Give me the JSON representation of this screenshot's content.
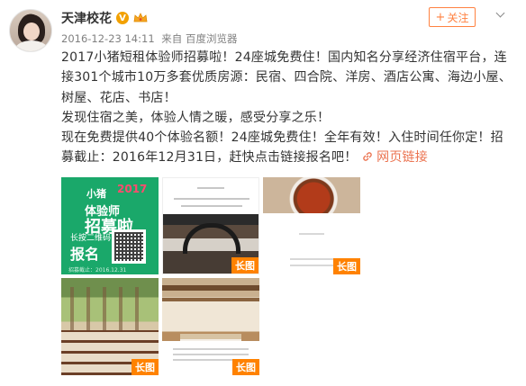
{
  "user": {
    "name": "天津校花",
    "vip_badge": "V",
    "follow_label": "关注",
    "follow_plus": "+"
  },
  "meta": {
    "date": "2016-12-23 14:11",
    "source_prefix": "来自",
    "source": "百度浏览器"
  },
  "post": {
    "paragraph1": "2017小猪短租体验师招募啦！24座城免费住！国内知名分享经济住宿平台，连接301个城市10万多套优质房源：民宿、四合院、洋房、酒店公寓、海边小屋、树屋、花店、书店！",
    "paragraph2": "发现住宿之美，体验人情之暖，感受分享之乐！",
    "paragraph3": "现在免费提供40个体验名额！24座城免费住！全年有效！入住时间任你定！招募截止：2016年12月31日，赶快点击链接报名吧！",
    "link_label": "网页链接"
  },
  "images": {
    "long_badge": "长图",
    "poster": {
      "brand": "小猪",
      "year": "2017",
      "title": "体验师",
      "title2": "招募啦",
      "qr_note": "长按二维码",
      "signup": "报名",
      "footer": "招募截止：2016.12.31"
    }
  },
  "colors": {
    "accent": "#eb7350",
    "follow": "#ff8140",
    "badge": "#ff8200",
    "poster_green": "#1aa86a"
  }
}
